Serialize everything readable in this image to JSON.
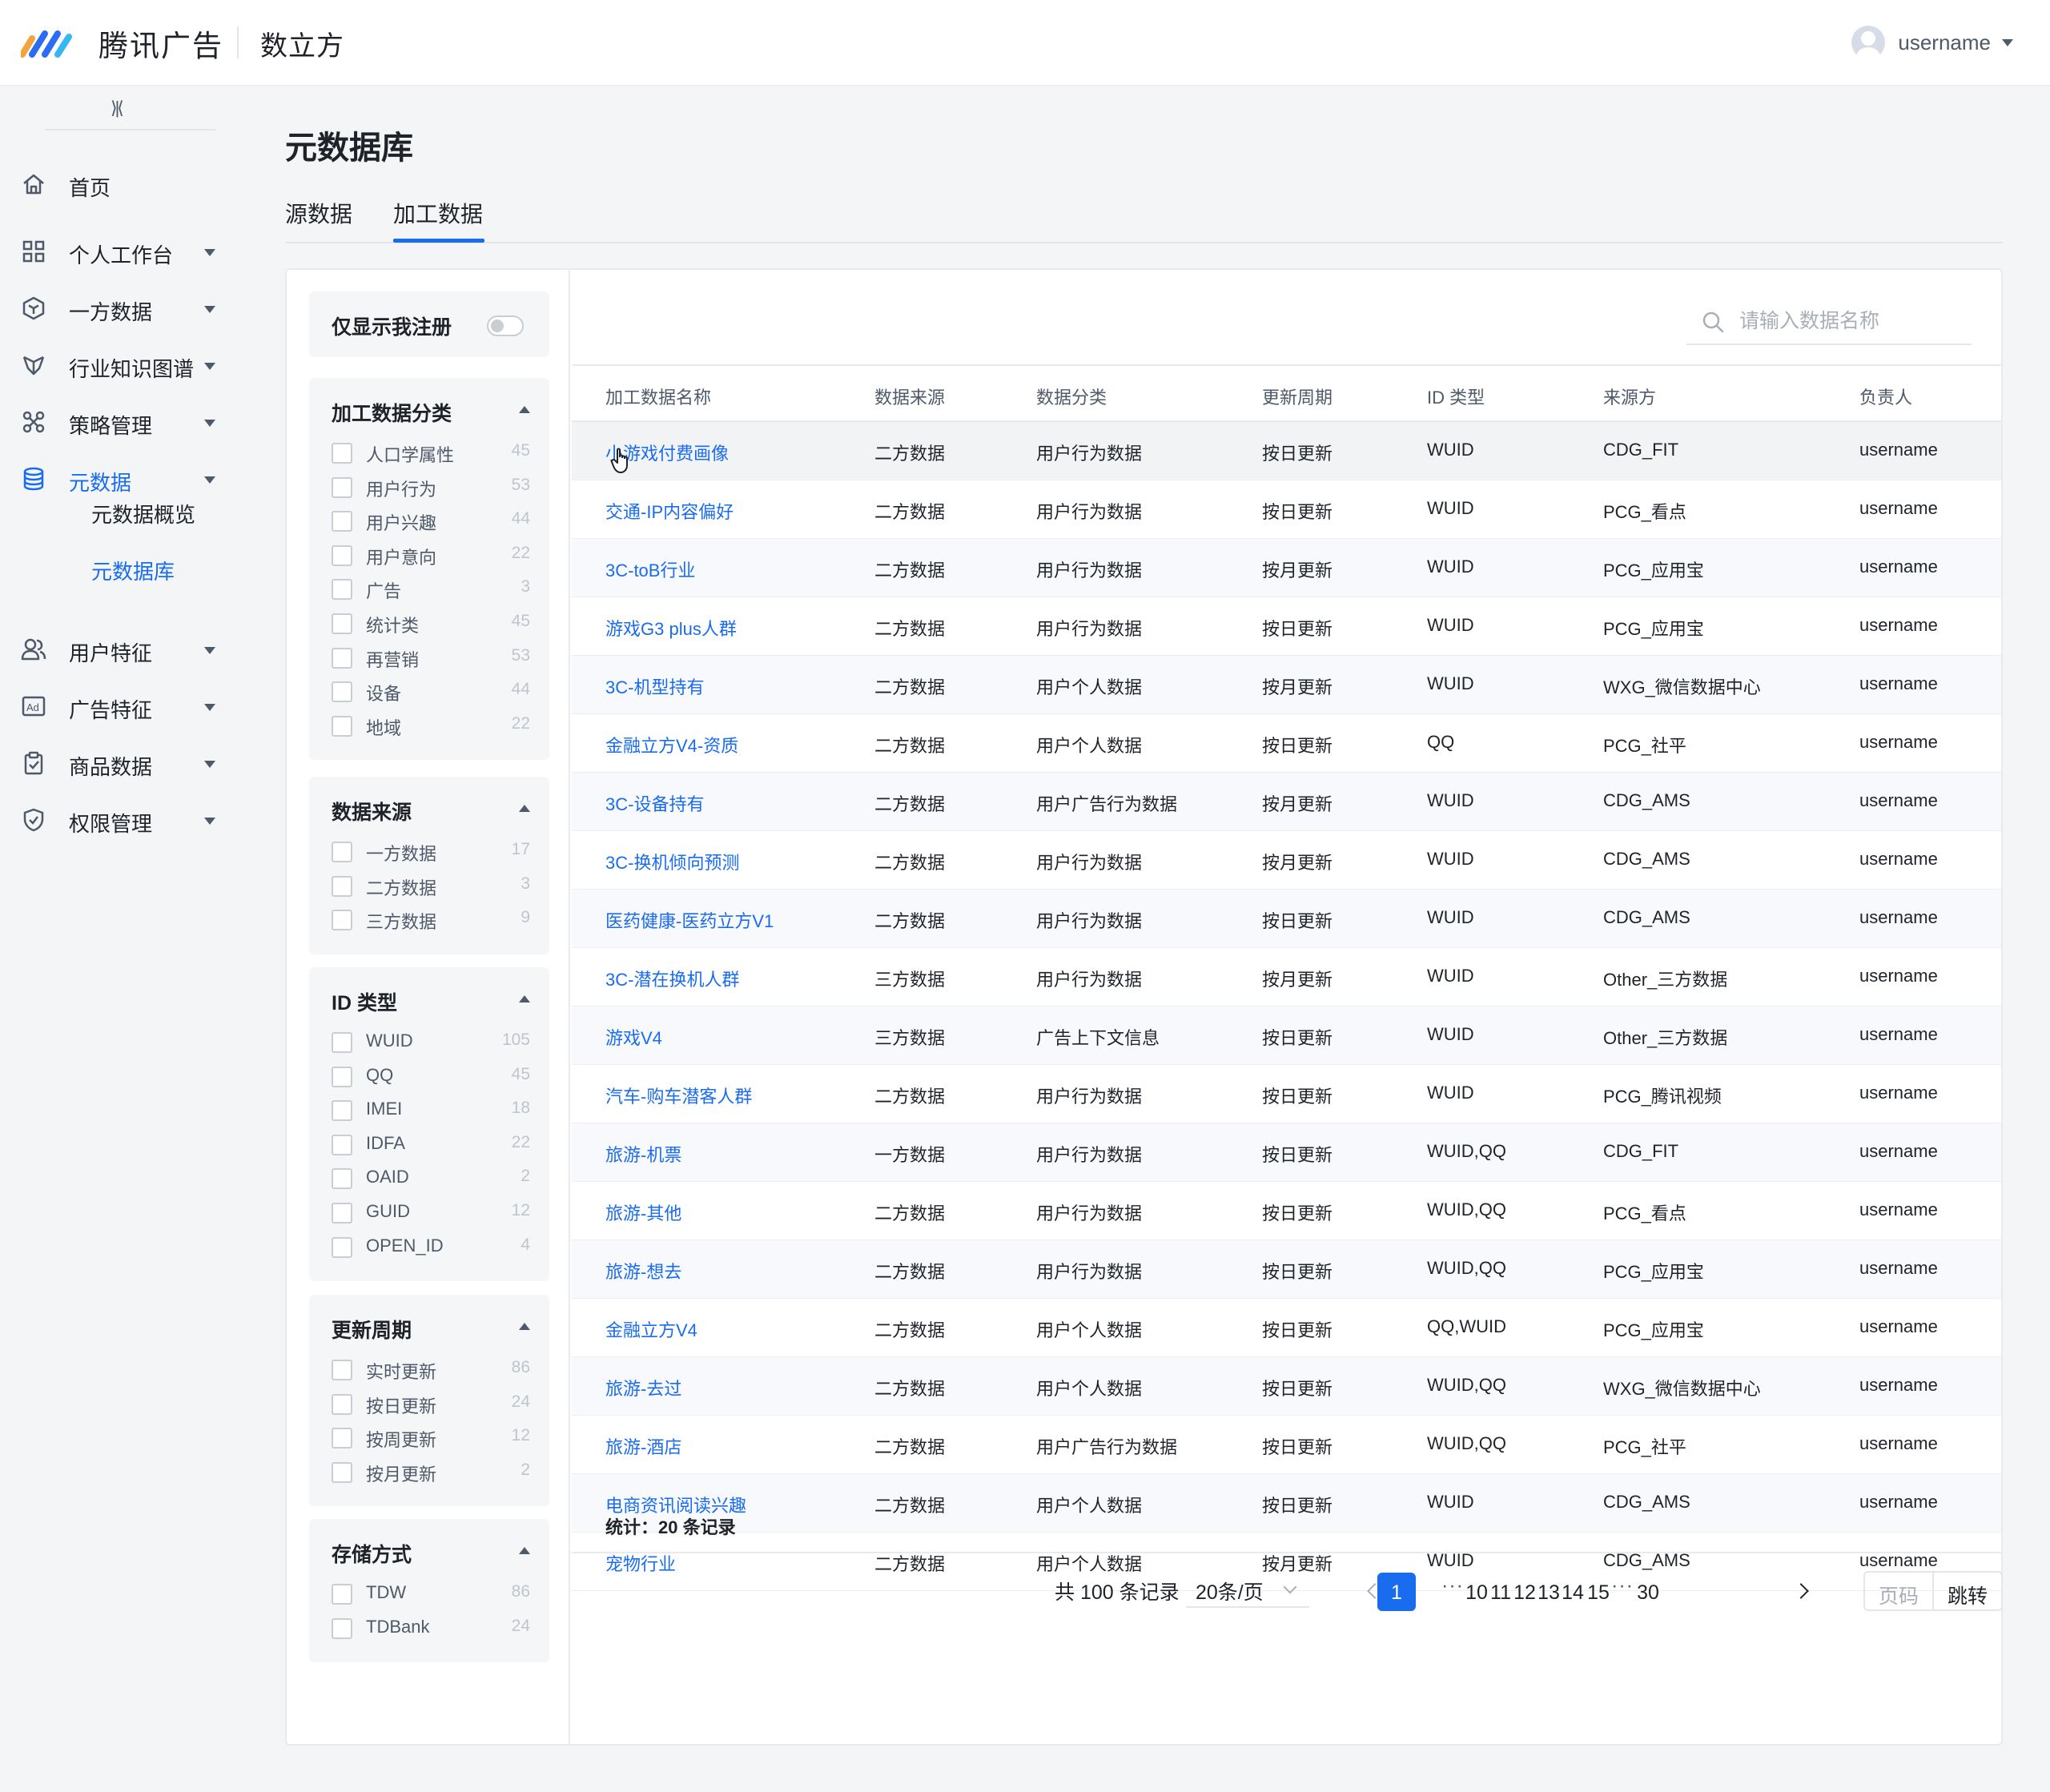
{
  "header": {
    "brand": "腾讯广告",
    "product": "数立方",
    "username": "username"
  },
  "sidebar": {
    "collapse_icon": "collapse-icon",
    "items": [
      {
        "label": "首页",
        "icon": "home-icon"
      },
      {
        "label": "个人工作台",
        "icon": "grid-icon"
      },
      {
        "label": "一方数据",
        "icon": "cube-icon"
      },
      {
        "label": "行业知识图谱",
        "icon": "graph-icon"
      },
      {
        "label": "策略管理",
        "icon": "strategy-icon"
      },
      {
        "label": "元数据",
        "icon": "database-icon"
      },
      {
        "label": "用户特征",
        "icon": "users-icon"
      },
      {
        "label": "广告特征",
        "icon": "ad-icon"
      },
      {
        "label": "商品数据",
        "icon": "clipboard-icon"
      },
      {
        "label": "权限管理",
        "icon": "shield-icon"
      }
    ],
    "sub_items": [
      "元数据概览",
      "元数据库"
    ]
  },
  "page": {
    "title": "元数据库",
    "tabs": [
      "源数据",
      "加工数据"
    ]
  },
  "filters": {
    "toggle_label": "仅显示我注册",
    "groups": [
      {
        "title": "加工数据分类",
        "options": [
          {
            "label": "人口学属性",
            "count": "45"
          },
          {
            "label": "用户行为",
            "count": "53"
          },
          {
            "label": "用户兴趣",
            "count": "44"
          },
          {
            "label": "用户意向",
            "count": "22"
          },
          {
            "label": "广告",
            "count": "3"
          },
          {
            "label": "统计类",
            "count": "45"
          },
          {
            "label": "再营销",
            "count": "53"
          },
          {
            "label": "设备",
            "count": "44"
          },
          {
            "label": "地域",
            "count": "22"
          }
        ]
      },
      {
        "title": "数据来源",
        "options": [
          {
            "label": "一方数据",
            "count": "17"
          },
          {
            "label": "二方数据",
            "count": "3"
          },
          {
            "label": "三方数据",
            "count": "9"
          }
        ]
      },
      {
        "title": "ID 类型",
        "options": [
          {
            "label": "WUID",
            "count": "105"
          },
          {
            "label": "QQ",
            "count": "45"
          },
          {
            "label": "IMEI",
            "count": "18"
          },
          {
            "label": "IDFA",
            "count": "22"
          },
          {
            "label": "OAID",
            "count": "2"
          },
          {
            "label": "GUID",
            "count": "12"
          },
          {
            "label": "OPEN_ID",
            "count": "4"
          }
        ]
      },
      {
        "title": "更新周期",
        "options": [
          {
            "label": "实时更新",
            "count": "86"
          },
          {
            "label": "按日更新",
            "count": "24"
          },
          {
            "label": "按周更新",
            "count": "12"
          },
          {
            "label": "按月更新",
            "count": "2"
          }
        ]
      },
      {
        "title": "存储方式",
        "options": [
          {
            "label": "TDW",
            "count": "86"
          },
          {
            "label": "TDBank",
            "count": "24"
          }
        ]
      }
    ]
  },
  "search": {
    "placeholder": "请输入数据名称"
  },
  "table": {
    "columns": [
      "加工数据名称",
      "数据来源",
      "数据分类",
      "更新周期",
      "ID 类型",
      "来源方",
      "负责人"
    ],
    "rows": [
      [
        "小游戏付费画像",
        "二方数据",
        "用户行为数据",
        "按日更新",
        "WUID",
        "CDG_FIT",
        "username"
      ],
      [
        "交通-IP内容偏好",
        "二方数据",
        "用户行为数据",
        "按日更新",
        "WUID",
        "PCG_看点",
        "username"
      ],
      [
        "3C-toB行业",
        "二方数据",
        "用户行为数据",
        "按月更新",
        "WUID",
        "PCG_应用宝",
        "username"
      ],
      [
        "游戏G3 plus人群",
        "二方数据",
        "用户行为数据",
        "按日更新",
        "WUID",
        "PCG_应用宝",
        "username"
      ],
      [
        "3C-机型持有",
        "二方数据",
        "用户个人数据",
        "按月更新",
        "WUID",
        "WXG_微信数据中心",
        "username"
      ],
      [
        "金融立方V4-资质",
        "二方数据",
        "用户个人数据",
        "按日更新",
        "QQ",
        "PCG_社平",
        "username"
      ],
      [
        "3C-设备持有",
        "二方数据",
        "用户广告行为数据",
        "按月更新",
        "WUID",
        "CDG_AMS",
        "username"
      ],
      [
        "3C-换机倾向预测",
        "二方数据",
        "用户行为数据",
        "按月更新",
        "WUID",
        "CDG_AMS",
        "username"
      ],
      [
        "医药健康-医药立方V1",
        "二方数据",
        "用户行为数据",
        "按日更新",
        "WUID",
        "CDG_AMS",
        "username"
      ],
      [
        "3C-潜在换机人群",
        "三方数据",
        "用户行为数据",
        "按月更新",
        "WUID",
        "Other_三方数据",
        "username"
      ],
      [
        "游戏V4",
        "三方数据",
        "广告上下文信息",
        "按日更新",
        "WUID",
        "Other_三方数据",
        "username"
      ],
      [
        "汽车-购车潜客人群",
        "二方数据",
        "用户行为数据",
        "按日更新",
        "WUID",
        "PCG_腾讯视频",
        "username"
      ],
      [
        "旅游-机票",
        "一方数据",
        "用户行为数据",
        "按日更新",
        "WUID,QQ",
        "CDG_FIT",
        "username"
      ],
      [
        "旅游-其他",
        "二方数据",
        "用户行为数据",
        "按日更新",
        "WUID,QQ",
        "PCG_看点",
        "username"
      ],
      [
        "旅游-想去",
        "二方数据",
        "用户行为数据",
        "按日更新",
        "WUID,QQ",
        "PCG_应用宝",
        "username"
      ],
      [
        "金融立方V4",
        "二方数据",
        "用户个人数据",
        "按日更新",
        "QQ,WUID",
        "PCG_应用宝",
        "username"
      ],
      [
        "旅游-去过",
        "二方数据",
        "用户个人数据",
        "按日更新",
        "WUID,QQ",
        "WXG_微信数据中心",
        "username"
      ],
      [
        "旅游-酒店",
        "二方数据",
        "用户广告行为数据",
        "按日更新",
        "WUID,QQ",
        "PCG_社平",
        "username"
      ],
      [
        "电商资讯阅读兴趣",
        "二方数据",
        "用户个人数据",
        "按日更新",
        "WUID",
        "CDG_AMS",
        "username"
      ],
      [
        "宠物行业",
        "二方数据",
        "用户个人数据",
        "按月更新",
        "WUID",
        "CDG_AMS",
        "username"
      ]
    ],
    "summary": "统计：20 条记录"
  },
  "pagination": {
    "total": "共 100 条记录",
    "page_size": "20条/页",
    "pages": [
      "1",
      "10",
      "11",
      "12",
      "13",
      "14",
      "15",
      "30"
    ],
    "ellipsis": "···",
    "current": "1",
    "jump_placeholder": "页码",
    "jump_label": "跳转"
  }
}
